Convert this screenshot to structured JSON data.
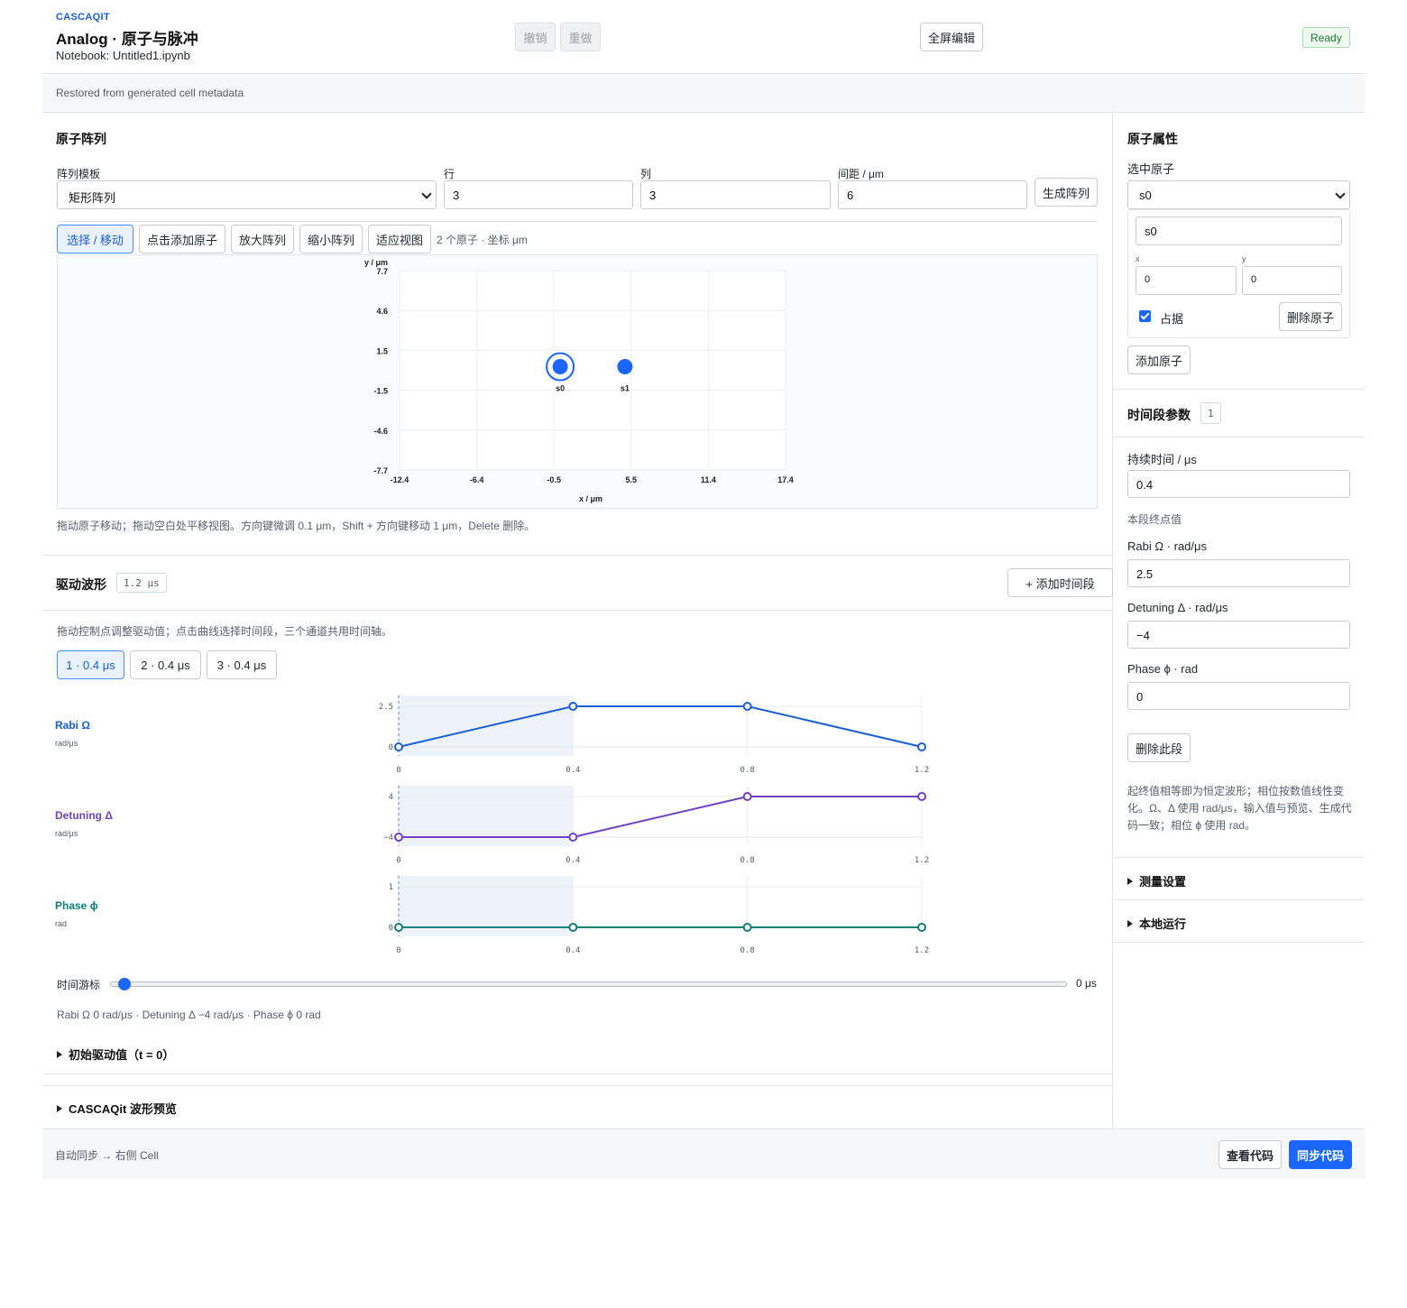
{
  "header": {
    "brand": "CASCAQIT",
    "title": "Analog · 原子与脉冲",
    "notebook": "Notebook: Untitled1.ipynb",
    "undo": "撤销",
    "redo": "重做",
    "fullscreen": "全屏编辑",
    "status": "Ready"
  },
  "restored": "Restored from generated cell metadata",
  "atoms": {
    "title": "原子阵列",
    "template_label": "阵列模板",
    "template_value": "矩形阵列",
    "rows_label": "行",
    "rows_value": "3",
    "cols_label": "列",
    "cols_value": "3",
    "spacing_label": "间距 / μm",
    "spacing_value": "6",
    "generate": "生成阵列",
    "tools": [
      "选择 / 移动",
      "点击添加原子",
      "放大阵列",
      "缩小阵列",
      "适应视图"
    ],
    "tool_info": "2 个原子 · 坐标 μm",
    "plot": {
      "ylabel": "y / μm",
      "xlabel": "x / μm",
      "yticks": [
        "7.7",
        "4.6",
        "1.5",
        "-1.5",
        "-4.6",
        "-7.7"
      ],
      "xticks": [
        "-12.4",
        "-6.4",
        "-0.5",
        "5.5",
        "11.4",
        "17.4"
      ],
      "atoms": [
        {
          "name": "s0",
          "x": 0,
          "y": 0,
          "selected": true
        },
        {
          "name": "s1",
          "x": 5,
          "y": 0,
          "selected": false
        }
      ]
    },
    "hint": "拖动原子移动；拖动空白处平移视图。方向键微调 0.1 μm，Shift + 方向键移动 1 μm，Delete 删除。"
  },
  "waveform": {
    "title": "驱动波形",
    "duration_badge": "1.2 μs",
    "add_segment": "+ 添加时间段",
    "hint": "拖动控制点调整驱动值；点击曲线选择时间段，三个通道共用时间轴。",
    "segments": [
      "1 · 0.4 μs",
      "2 · 0.4 μs",
      "3 · 0.4 μs"
    ],
    "channels": [
      {
        "name": "Rabi Ω",
        "unit": "rad/μs",
        "color": "#1a5fd6",
        "yticks": [
          "2.5",
          "0"
        ],
        "ymin": 0,
        "ymax": 2.5,
        "t": [
          0,
          0.4,
          0.8,
          1.2
        ],
        "v": [
          0,
          2.5,
          2.5,
          0
        ]
      },
      {
        "name": "Detuning Δ",
        "unit": "rad/μs",
        "color": "#6f42c1",
        "yticks": [
          "4",
          "−4"
        ],
        "ymin": -4,
        "ymax": 4,
        "t": [
          0,
          0.4,
          0.8,
          1.2
        ],
        "v": [
          -4,
          -4,
          4,
          4
        ]
      },
      {
        "name": "Phase ϕ",
        "unit": "rad",
        "color": "#0f7f7a",
        "yticks": [
          "1",
          "0"
        ],
        "ymin": 0,
        "ymax": 1,
        "t": [
          0,
          0.4,
          0.8,
          1.2
        ],
        "v": [
          0,
          0,
          0,
          0
        ]
      }
    ],
    "xticks": [
      "0",
      "0.4",
      "0.8",
      "1.2"
    ],
    "time_cursor_label": "时间游标",
    "time_cursor_value": "0 μs",
    "time_cursor_fraction": 0.0,
    "readout": "Rabi Ω 0 rad/μs · Detuning Δ −4 rad/μs · Phase ϕ 0 rad",
    "initial": "初始驱动值（t = 0）"
  },
  "preview": "CASCAQit 波形预览",
  "footer": {
    "sync_info": "自动同步 → 右侧 Cell",
    "view_code": "查看代码",
    "sync_code": "同步代码"
  },
  "props": {
    "title": "原子属性",
    "selected_label": "选中原子",
    "selected_value": "s0",
    "name_value": "s0",
    "x_label": "x",
    "x_value": "0",
    "y_label": "y",
    "y_value": "0",
    "occupied_label": "占据",
    "delete_atom": "删除原子",
    "add_atom": "添加原子"
  },
  "segment_params": {
    "title": "时间段参数",
    "index": "1",
    "duration_label": "持续时间 / μs",
    "duration_value": "0.4",
    "endpoint_label": "本段终点值",
    "rabi_label": "Rabi Ω · rad/μs",
    "rabi_value": "2.5",
    "detuning_label": "Detuning Δ · rad/μs",
    "detuning_value": "−4",
    "phase_label": "Phase ϕ · rad",
    "phase_value": "0",
    "delete_segment": "删除此段",
    "note": "起终值相等即为恒定波形；相位按数值线性变化。Ω、Δ 使用 rad/μs，输入值与预览、生成代码一致；相位 ϕ 使用 rad。"
  },
  "measure": "测量设置",
  "local_run": "本地运行"
}
